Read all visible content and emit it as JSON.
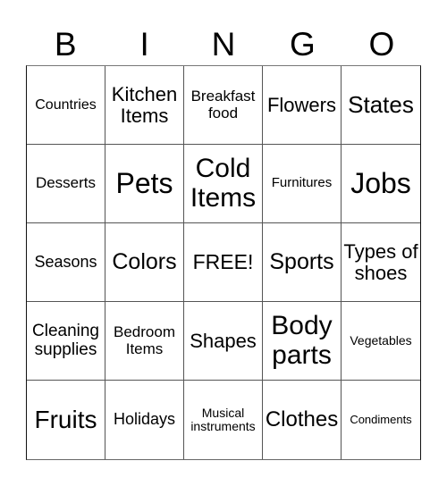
{
  "header": {
    "letters": [
      "B",
      "I",
      "N",
      "G",
      "O"
    ]
  },
  "card": {
    "rows": [
      [
        "Countries",
        "Kitchen Items",
        "Breakfast food",
        "Flowers",
        "States"
      ],
      [
        "Desserts",
        "Pets",
        "Cold Items",
        "Furnitures",
        "Jobs"
      ],
      [
        "Seasons",
        "Colors",
        "FREE!",
        "Sports",
        "Types of shoes"
      ],
      [
        "Cleaning supplies",
        "Bedroom Items",
        "Shapes",
        "Body parts",
        "Vegetables"
      ],
      [
        "Fruits",
        "Holidays",
        "Musical instruments",
        "Clothes",
        "Condiments"
      ]
    ]
  }
}
